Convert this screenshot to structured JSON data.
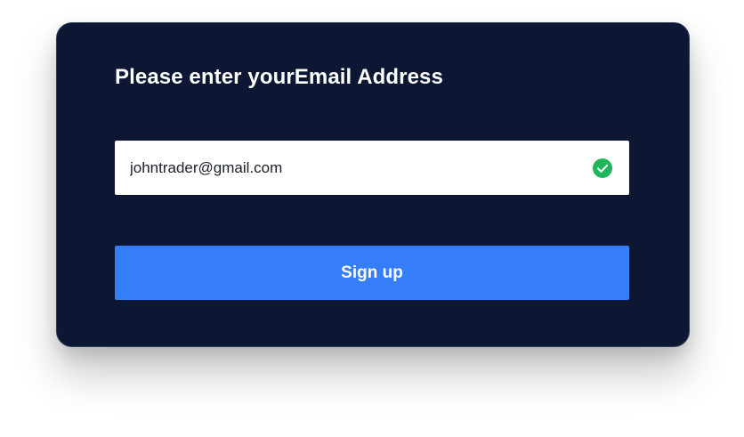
{
  "form": {
    "title": "Please enter yourEmail Address",
    "email_value": "johntrader@gmail.com",
    "email_valid_icon": "check-circle-icon",
    "submit_label": "Sign up"
  },
  "colors": {
    "card_background": "#0d1733",
    "accent": "#357ef8",
    "valid": "#22b45a",
    "text_on_dark": "#ffffff"
  }
}
